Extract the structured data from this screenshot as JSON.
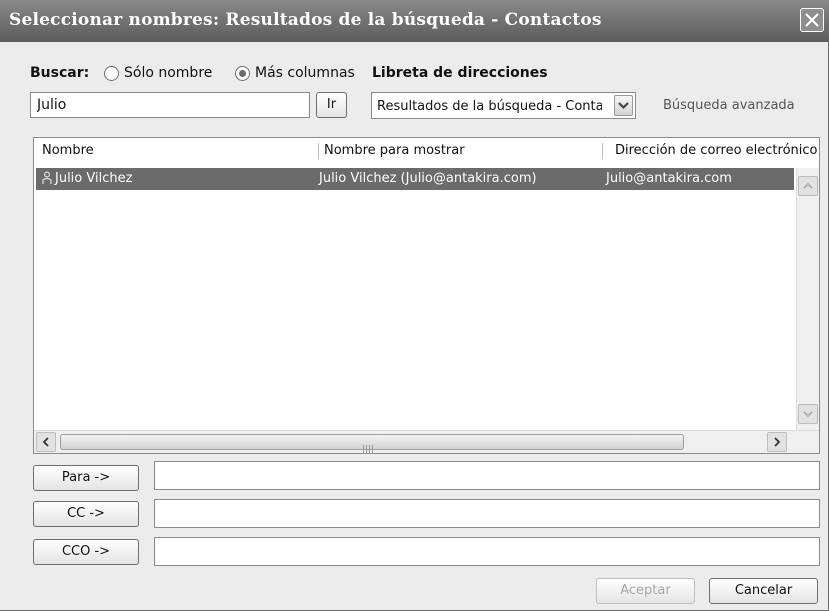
{
  "window": {
    "title": "Seleccionar nombres: Resultados de la búsqueda - Contactos"
  },
  "search": {
    "label": "Buscar:",
    "option_name_only": "Sólo nombre",
    "option_more_columns": "Más columnas",
    "selected_option": "Más columnas",
    "query_value": "Julio",
    "go_button": "Ir",
    "address_book_label": "Libreta de direcciones",
    "address_book_value": "Resultados de la búsqueda - Contactos",
    "advanced_link": "Búsqueda avanzada"
  },
  "list": {
    "columns": [
      "Nombre",
      "Nombre para mostrar",
      "Dirección de correo electrónico"
    ],
    "rows": [
      {
        "name": "Julio Vilchez",
        "display_name": "Julio Vilchez (Julio@antakira.com)",
        "email": "Julio@antakira.com",
        "selected": true
      }
    ]
  },
  "recipients": {
    "to_button": "Para ->",
    "cc_button": "CC ->",
    "bcc_button": "CCO ->",
    "to_value": "",
    "cc_value": "",
    "bcc_value": ""
  },
  "footer": {
    "ok_button": "Aceptar",
    "cancel_button": "Cancelar"
  },
  "icons": {
    "contact": "contact-card-icon",
    "close": "close-icon"
  },
  "colors": {
    "titlebar": "#6f6f6f",
    "selection": "#6b6b6b",
    "dialog_bg": "#ececec"
  }
}
